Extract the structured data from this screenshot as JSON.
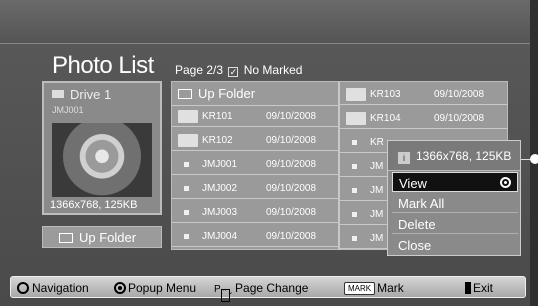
{
  "header": {
    "title": "Photo List",
    "page": "Page 2/3",
    "marked": "No Marked"
  },
  "preview": {
    "drive": "Drive 1",
    "filename": "JMJ001",
    "resolution": "1366x768, 125KB"
  },
  "up_button": "Up Folder",
  "list": {
    "up_folder": "Up Folder",
    "left": [
      {
        "type": "folder",
        "name": "KR101",
        "date": "09/10/2008"
      },
      {
        "type": "folder",
        "name": "KR102",
        "date": "09/10/2008"
      },
      {
        "type": "file",
        "name": "JMJ001",
        "date": "09/10/2008"
      },
      {
        "type": "file",
        "name": "JMJ002",
        "date": "09/10/2008"
      },
      {
        "type": "file",
        "name": "JMJ003",
        "date": "09/10/2008"
      },
      {
        "type": "file",
        "name": "JMJ004",
        "date": "09/10/2008"
      }
    ],
    "right": [
      {
        "type": "folder",
        "name": "KR103",
        "date": "09/10/2008"
      },
      {
        "type": "folder",
        "name": "KR104",
        "date": "09/10/2008"
      },
      {
        "type": "file",
        "name": "KR",
        "date": ""
      },
      {
        "type": "file",
        "name": "JM",
        "date": ""
      },
      {
        "type": "file",
        "name": "JM",
        "date": ""
      },
      {
        "type": "file",
        "name": "JM",
        "date": ""
      },
      {
        "type": "file",
        "name": "JM",
        "date": ""
      }
    ]
  },
  "popup": {
    "info": "1366x768, 125KB",
    "items": [
      "View",
      "Mark All",
      "Delete",
      "Close"
    ]
  },
  "helpbar": {
    "navigation": "Navigation",
    "popup_menu": "Popup Menu",
    "page_change": "Page Change",
    "mark_key": "MARK",
    "mark": "Mark",
    "exit": "Exit"
  },
  "icons": [
    "folder-icon",
    "checkbox-icon",
    "info-icon",
    "radio-selected-icon",
    "dpad-icon",
    "ok-button-icon",
    "page-key-icon",
    "exit-icon"
  ]
}
